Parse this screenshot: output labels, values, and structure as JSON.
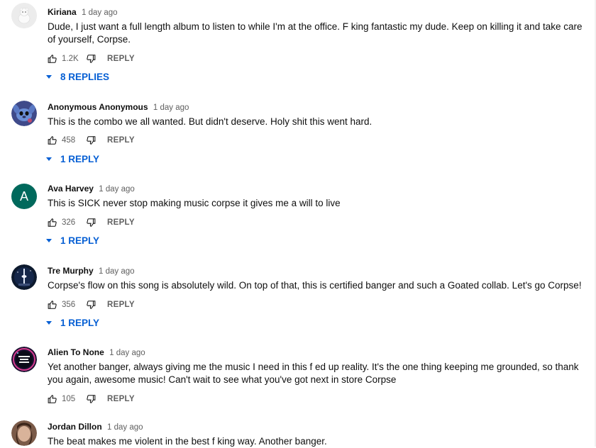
{
  "comments": [
    {
      "author": "Kiriana",
      "time": "1 day ago",
      "text": "Dude, I just want a full length album to listen to while I'm at the office. F   king fantastic my dude. Keep on killing it and take care of yourself, Corpse.",
      "likes": "1.2K",
      "reply_label": "REPLY",
      "replies_label": "8 REPLIES",
      "avatar_icon": "polar-bear-avatar"
    },
    {
      "author": "Anonymous Anonymous",
      "time": "1 day ago",
      "text": "This is the combo we all wanted. But didn't deserve. Holy shit this went hard.",
      "likes": "458",
      "reply_label": "REPLY",
      "replies_label": "1 REPLY",
      "avatar_icon": "stitch-avatar"
    },
    {
      "author": "Ava Harvey",
      "time": "1 day ago",
      "text": "This is SICK never stop making music corpse it gives me a will to live",
      "likes": "326",
      "reply_label": "REPLY",
      "replies_label": "1 REPLY",
      "avatar_letter": "A",
      "avatar_color": "#00695c"
    },
    {
      "author": "Tre Murphy",
      "time": "1 day ago",
      "text": "Corpse's flow on this song is absolutely wild. On top of that, this is certified banger and such a Goated collab. Let's go Corpse!",
      "likes": "356",
      "reply_label": "REPLY",
      "replies_label": "1 REPLY",
      "avatar_icon": "tower-night-avatar"
    },
    {
      "author": "Alien To None",
      "time": "1 day ago",
      "text": "Yet another banger, always giving me the music I need in this f      ed up reality. It's the one thing keeping me grounded, so thank you again, awesome music! Can't wait to see what you've got next in store Corpse",
      "likes": "105",
      "reply_label": "REPLY",
      "avatar_icon": "alien-logo-avatar"
    },
    {
      "author": "Jordan Dillon",
      "time": "1 day ago",
      "text": "The beat makes me violent in the best f   king way. Another banger.",
      "avatar_icon": "person-photo-avatar"
    }
  ],
  "colors": {
    "link_blue": "#065fd4",
    "meta_gray": "#606060",
    "text": "#0f0f0f"
  }
}
